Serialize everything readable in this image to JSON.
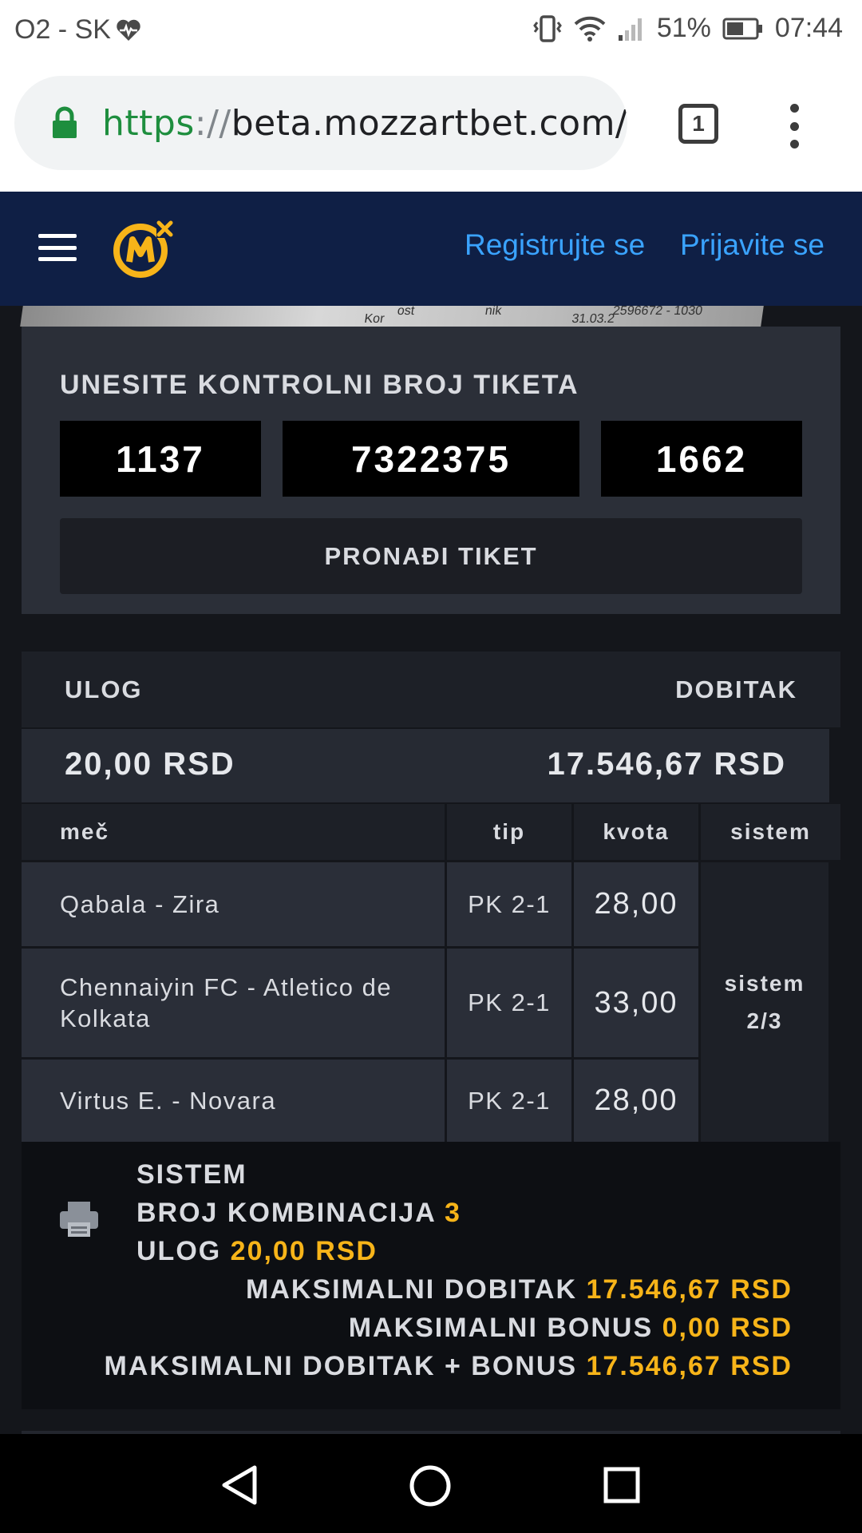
{
  "status_bar": {
    "carrier": "O2 - SK",
    "battery": "51%",
    "time": "07:44"
  },
  "browser": {
    "url_scheme": "https",
    "url_separator": "://",
    "url_host": "beta.mozzartbet.com/",
    "tab_count": "1"
  },
  "header": {
    "register_label": "Registrujte se",
    "login_label": "Prijavite se"
  },
  "banner_text": {
    "a": "ost",
    "b": "nik",
    "c": "2596672 - 1030",
    "d": "Kor",
    "e": "31.03.2"
  },
  "ticket_search": {
    "title": "UNESITE KONTROLNI BROJ TIKETA",
    "code_1": "1137",
    "code_2": "7322375",
    "code_3": "1662",
    "find_label": "PRONAĐI TIKET"
  },
  "ticket": {
    "stake_label": "ULOG",
    "win_label": "DOBITAK",
    "stake_value": "20,00 RSD",
    "win_value": "17.546,67 RSD",
    "columns": {
      "match": "meč",
      "tip": "tip",
      "odds": "kvota",
      "system": "sistem"
    },
    "rows": [
      {
        "match": "Qabala - Zira",
        "tip": "PK 2-1",
        "odds": "28,00"
      },
      {
        "match": "Chennaiyin FC - Atletico de Kolkata",
        "tip": "PK 2-1",
        "odds": "33,00"
      },
      {
        "match": "Virtus E. - Novara",
        "tip": "PK 2-1",
        "odds": "28,00"
      }
    ],
    "system_word": "sistem",
    "system_value": "2/3"
  },
  "summary": {
    "system_label": "SISTEM",
    "combinations_label": "BROJ KOMBINACIJA",
    "combinations_value": "3",
    "stake_label": "ULOG",
    "stake_value": "20,00 RSD",
    "max_win_label": "MAKSIMALNI DOBITAK",
    "max_win_value": "17.546,67 RSD",
    "max_bonus_label": "MAKSIMALNI BONUS",
    "max_bonus_value": "0,00 RSD",
    "max_total_label": "MAKSIMALNI DOBITAK + BONUS",
    "max_total_value": "17.546,67 RSD"
  },
  "colors": {
    "header_bg": "#0f1f45",
    "link": "#3aa3ff",
    "highlight": "#f7b419",
    "logo": "#f7b419"
  },
  "icons": [
    "heart-monitor-icon",
    "vibrate-icon",
    "wifi-icon",
    "signal-icon",
    "battery-icon",
    "lock-icon",
    "menu-icon",
    "printer-icon",
    "back-icon",
    "home-icon",
    "recents-icon"
  ]
}
